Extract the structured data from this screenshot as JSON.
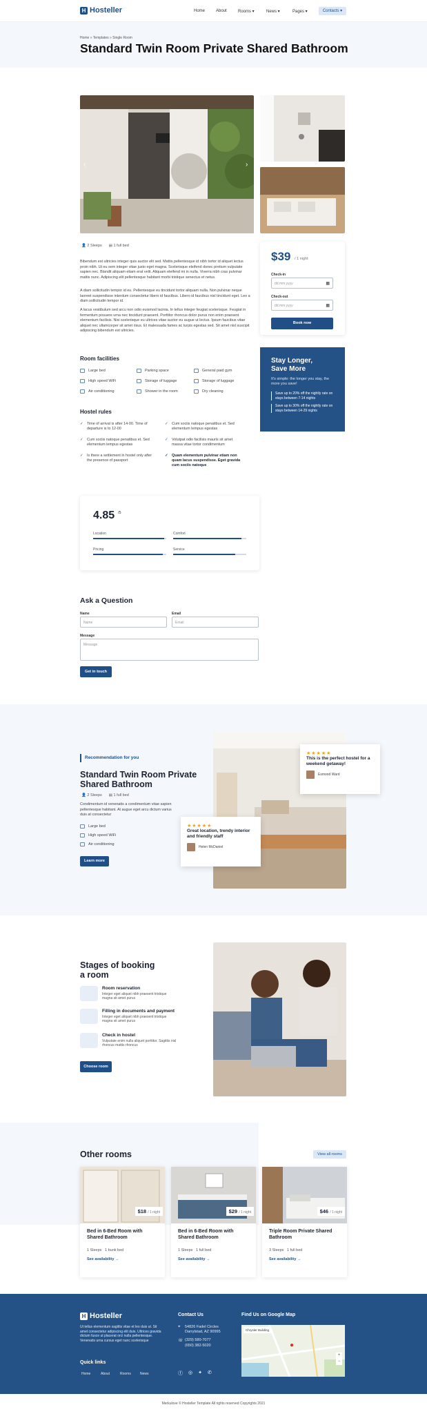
{
  "nav": {
    "logo": "Hosteller",
    "items": [
      "Home",
      "About",
      "Rooms ▾",
      "News ▾",
      "Pages ▾"
    ],
    "contacts": "Contacts ▾"
  },
  "breadcrumb": "Home » Templates » Single Room",
  "title": "Standard Twin Room Private Shared Bathroom",
  "room": {
    "sleeps": "2 Sleeps",
    "bed": "1 full bed",
    "desc1": "Bibendum est ultricies integer quis auctor elit sed. Mattis pellentesque id nibh tortor id aliquet lectus proin nibh. Ut eu sem integer vitae justo eget magna. Scelerisque eleifend donec pretium vulputate sapien nec. Blandit aliquam etiam erat velit. Aliquam eleifend mi in nulla. Viverra nibh cras pulvinar mattis nunc. Adipiscing elit pellentesque habitant morbi tristique senectus et netus.",
    "desc2": "A diam sollicitudin tempor id eu. Pellentesque eu tincidunt tortor aliquam nulla. Non pulvinar neque laoreet suspendisse interdum consectetur libero id faucibus. Libero id faucibus nisl tincidunt eget. Leo a diam sollicitudin tempor id.",
    "desc3": "A lacus vestibulum sed arcu non odio euismod lacinia. In tellus integer feugiat scelerisque. Feugiat in fermentum posuere urna nec tincidunt praesent. Porttitor rhoncus dolor purus non enim praesent elementum facilisis. Nisi scelerisque eu ultrices vitae auctor eu augue ut lectus. Ipsum faucibus vitae aliquet nec ullamcorper sit amet risus. Et malesuada fames ac turpis egestas sed. Sit amet nisl suscipit adipiscing bibendum est ultricies."
  },
  "facilities": {
    "title": "Room facilities",
    "items": [
      "Large bed",
      "Parking space",
      "General paid gym",
      "High speed WiFi",
      "Storage of luggage",
      "Storage of luggage",
      "Air conditioning",
      "Shower in the room",
      "Dry cleaning"
    ]
  },
  "rules": {
    "title": "Hostel rules",
    "items": [
      "Time of arrival is after 14-00. Time of departure is to 12-00",
      "Cum sociis natoque penatibus et. Sed elementum tempus egestas",
      "Cum sociis natoque penatibus et. Sed elementum tempus egestas",
      "Volutpat odio facilisis mauris sit amet massa vitae tortor condimentum",
      "Is there a settlement in hostel only after the presence of passport",
      "Quam elementum pulvinar etiam non quam lacus suspendisse. Eget gravida cum sociis natoque"
    ]
  },
  "booking": {
    "price": "$39",
    "per": "/ 1 night",
    "checkin_label": "Check-in",
    "checkout_label": "Check-out",
    "date_placeholder": "dd.mm.yyyy",
    "button": "Book now"
  },
  "promo": {
    "title": "Stay Longer, Save More",
    "text": "It's simple: the longer you stay, the more you save!",
    "line1": "Save up to 20% off the nightly rate on stays between 7-14 nights",
    "line2": "Save up to 30% off the nightly rate on stays between 14-29 nights"
  },
  "rating": {
    "score": "4.85",
    "out_of": "/5",
    "categories": [
      {
        "label": "Location",
        "value": 0.97
      },
      {
        "label": "Comfort",
        "value": 0.93
      },
      {
        "label": "Pricing",
        "value": 0.95
      },
      {
        "label": "Service",
        "value": 0.85
      }
    ]
  },
  "question": {
    "title": "Ask a Question",
    "name_label": "Name",
    "name_placeholder": "Name",
    "email_label": "Email",
    "email_placeholder": "Email",
    "message_label": "Message",
    "message_placeholder": "Message",
    "button": "Get in touch"
  },
  "recommend": {
    "kicker": "Recommendation for you",
    "title": "Standard Twin Room Private Shared Bathroom",
    "sleeps": "2 Sleeps",
    "bed": "1 full bed",
    "desc": "Condimentum id venenatis a condimentum vitae sapien pellentesque habitant. At augue eget arcu dictum varius duis at consectetur",
    "features": [
      "Large bed",
      "High speed WiFi",
      "Air conditioning"
    ],
    "button": "Learn more",
    "review1": {
      "stars": "★★★★★",
      "text": "This is the perfect hostel for a weekend getaway!",
      "author": "Esmond Ward"
    },
    "review2": {
      "stars": "★★★★★",
      "text": "Great location, trendy interior and friendly staff",
      "author": "Helen McDaniel"
    }
  },
  "stages": {
    "title": "Stages of booking a room",
    "items": [
      {
        "title": "Room reservation",
        "desc": "Integer eget aliquet nibh praesent tristique magna sit amet purus"
      },
      {
        "title": "Filling in documents and payment",
        "desc": "Integer eget aliquet nibh praesent tristique magna sit amet purus"
      },
      {
        "title": "Check in hostel",
        "desc": "Vulputate enim nulla aliquet porttitor. Sagittis nisl rhoncus mattis rhoncus"
      }
    ],
    "button": "Choose room"
  },
  "other_rooms": {
    "title": "Other rooms",
    "view_all": "View all rooms",
    "rooms": [
      {
        "price": "$18",
        "per": "/ 1 night",
        "title": "Bed in 6-Bed Room with Shared Bathroom",
        "sleeps": "1 Sleeps",
        "bed": "1 bunk bed",
        "link": "See availability →"
      },
      {
        "price": "$29",
        "per": "/ 1 night",
        "title": "Bed in 6-Bed Room with Shared Bathroom",
        "sleeps": "1 Sleeps",
        "bed": "1 full bed",
        "link": "See availability →"
      },
      {
        "price": "$46",
        "per": "/ 1 night",
        "title": "Triple Room Private Shared Bathroom",
        "sleeps": "3 Sleeps",
        "bed": "1 full bed",
        "link": "See availability →"
      }
    ]
  },
  "footer": {
    "logo": "Hosteller",
    "about": "Ut tellus elementum sagittis vitae et leo duis ut. Sit amet consectetur adipiscing elit duis. Ultrices gravida dictum fusce ut placerat orci nulla pellentesque. Venenatis urna cursus eget nunc scelerisque",
    "quick_title": "Quick links",
    "quick_links": [
      "Home",
      "About",
      "Rooms",
      "News"
    ],
    "contact_title": "Contact Us",
    "address": "54826 Fadel Circles Darrylstad, AZ 90995",
    "phone1": "(329) 580-7077",
    "phone2": "(650) 382-5020",
    "map_title": "Find Us on Google Map",
    "map_place": "Chrysler Building"
  },
  "copyright": "Merkulove © Hosteller Template All rights reserved Copyrights 2021"
}
